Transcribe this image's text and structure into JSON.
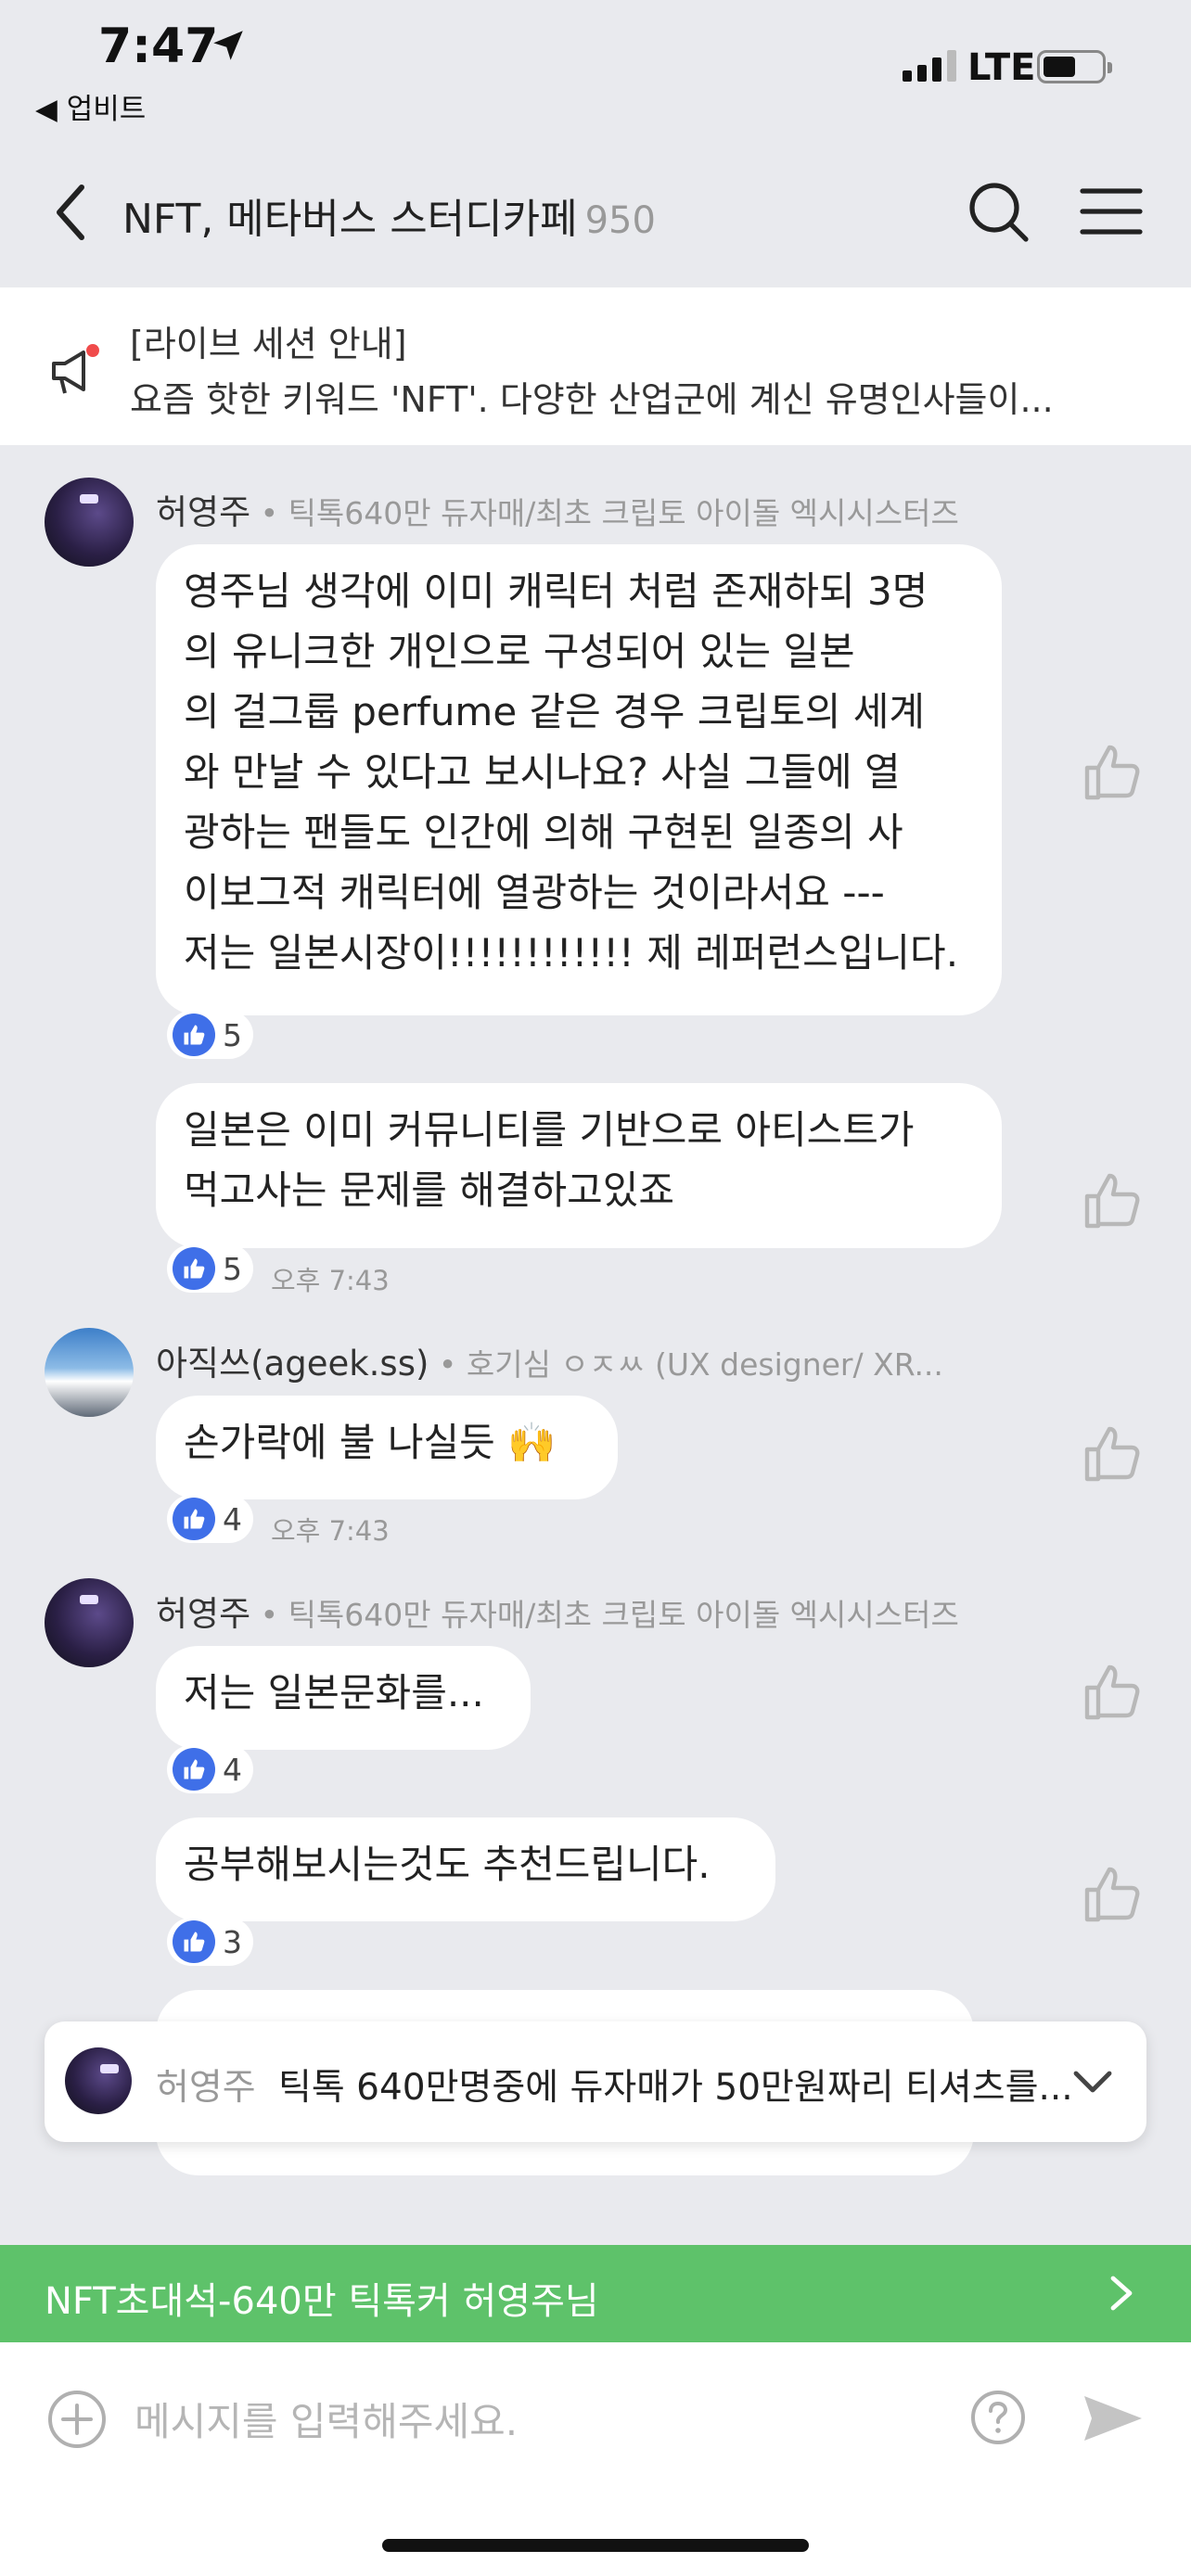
{
  "status_bar": {
    "time": "7:47",
    "back_app": "◀ 업비트",
    "network": "LTE"
  },
  "header": {
    "title": "NFT, 메타버스 스터디카페",
    "member_count": "950"
  },
  "notice": {
    "title": "[라이브 세션 안내]",
    "body": "요즘 핫한 키워드 'NFT'. 다양한 산업군에 계신 유명인사들이..."
  },
  "messages": [
    {
      "sender": "허영주",
      "sender_desc": " • 틱톡640만 듀자매/최초 크립토 아이돌 엑시시스터즈",
      "bubbles": [
        {
          "lines": [
            "영주님 생각에 이미 캐릭터 처럼 존재하되 3명",
            "의 유니크한 개인으로 구성되어 있는 일본",
            "의 걸그룹 perfume 같은 경우 크립토의 세계",
            "와 만날 수 있다고 보시나요? 사실 그들에 열",
            "광하는 팬들도 인간에 의해 구현된 일종의 사",
            "이보그적 캐릭터에 열광하는 것이라서요 ---",
            "저는 일본시장이!!!!!!!!!!!! 제 레퍼런스입니다."
          ],
          "likes": "5",
          "time": ""
        },
        {
          "lines": [
            "일본은 이미 커뮤니티를 기반으로 아티스트가",
            "먹고사는 문제를 해결하고있죠"
          ],
          "likes": "5",
          "time": "오후 7:43"
        }
      ]
    },
    {
      "sender": "아직쓰(ageek.ss)",
      "sender_desc": " • 호기심 ㅇㅈㅆ (UX designer/ XR...",
      "bubbles": [
        {
          "lines": [
            "손가락에 불 나실듯 🙌"
          ],
          "likes": "4",
          "time": "오후 7:43"
        }
      ]
    },
    {
      "sender": "허영주",
      "sender_desc": " • 틱톡640만 듀자매/최초 크립토 아이돌 엑시시스터즈",
      "bubbles": [
        {
          "lines": [
            "저는 일본문화를..."
          ],
          "likes": "4",
          "time": ""
        },
        {
          "lines": [
            "공부해보시는것도 추천드립니다."
          ],
          "likes": "3",
          "time": ""
        }
      ]
    }
  ],
  "pinned": {
    "name": "허영주",
    "text": "틱톡 640만명중에 듀자매가 50만원짜리 티셔츠를..."
  },
  "banner": {
    "text": "NFT초대석-640만 틱톡커 허영주님"
  },
  "composer": {
    "placeholder": "메시지를 입력해주세요."
  },
  "colors": {
    "background": "#e9eaee",
    "banner": "#5ec26a",
    "like_badge": "#3f6fe8"
  }
}
